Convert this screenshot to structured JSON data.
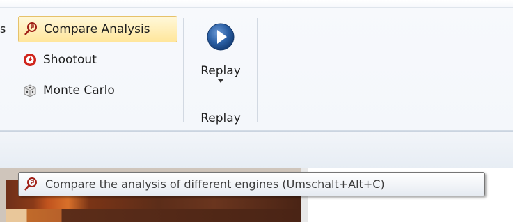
{
  "ribbon": {
    "truncated_left_glyph": "s",
    "items": [
      {
        "label": "Compare Analysis",
        "icon": "compare-analysis-icon"
      },
      {
        "label": "Shootout",
        "icon": "shootout-icon"
      },
      {
        "label": "Monte Carlo",
        "icon": "monte-carlo-dice-icon"
      }
    ],
    "replay_button": {
      "label": "Replay",
      "icon": "replay-play-icon"
    },
    "group_label": "Replay"
  },
  "tooltip": {
    "icon": "compare-analysis-icon",
    "text": "Compare the analysis of different engines (Umschalt+Alt+C)"
  },
  "colors": {
    "hover_highlight": "#ffe69b",
    "replay_circle": "#2a5fa4",
    "shootout_red": "#d0241c"
  }
}
